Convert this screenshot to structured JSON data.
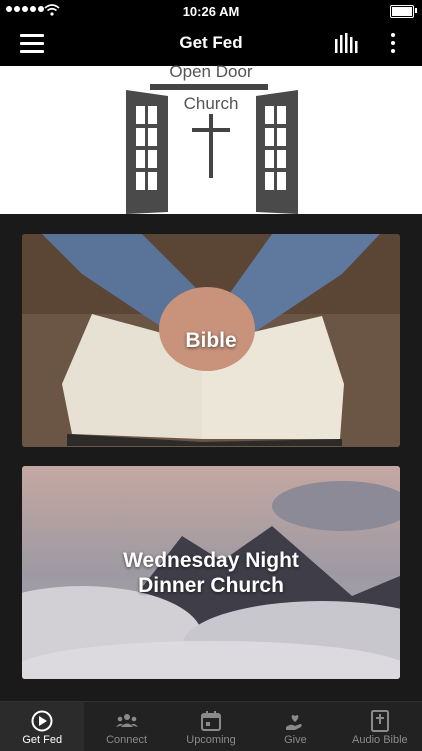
{
  "status": {
    "time": "10:26 AM"
  },
  "appbar": {
    "title": "Get Fed"
  },
  "hero": {
    "line1": "Open Door",
    "line2": "Church"
  },
  "cards": [
    {
      "title": "Bible"
    },
    {
      "title": "Wednesday Night",
      "title2": "Dinner Church"
    }
  ],
  "tabs": [
    {
      "label": "Get Fed",
      "icon": "play-circle-icon"
    },
    {
      "label": "Connect",
      "icon": "people-icon"
    },
    {
      "label": "Upcoming",
      "icon": "calendar-icon"
    },
    {
      "label": "Give",
      "icon": "heart-hand-icon"
    },
    {
      "label": "Audio Bible",
      "icon": "bible-icon"
    }
  ]
}
